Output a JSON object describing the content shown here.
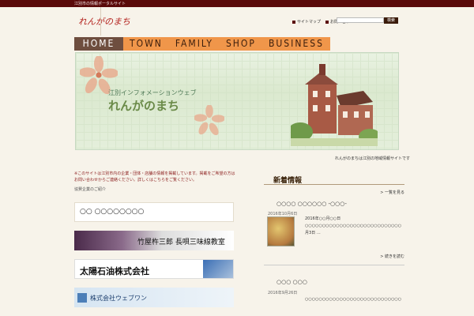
{
  "topbar": {
    "text": "江別市の情報ポータルサイト"
  },
  "header": {
    "logo": "れんがのまち",
    "links": [
      {
        "label": "サイトマップ"
      },
      {
        "label": "お問い合わせ"
      }
    ],
    "search": {
      "placeholder": "",
      "button": "検索"
    }
  },
  "nav": {
    "home": "HOME",
    "items": [
      "TOWN",
      "FAMILY",
      "SHOP",
      "BUSINESS"
    ]
  },
  "banner": {
    "subtitle": "江別インフォメーションウェブ",
    "title": "れんがのまち"
  },
  "below_banner": "れんがのまちは江別の地域情報サイトです",
  "main": {
    "notice": "※このサイトは江別市内の企業・団体・店舗の情報を掲載しています。掲載をご希望の方はお問い合わせからご連絡ください。詳しくはこちらをご覧ください。",
    "small": "協賛企業のご紹介",
    "banners": [
      {
        "title": "○○ ○○○○○○○○",
        "type": "text"
      },
      {
        "title": "竹屋杵三郎 長唄三味線教室",
        "type": "dark"
      },
      {
        "title": "太陽石油株式会社",
        "type": "light"
      },
      {
        "title": "株式会社ウェブワン",
        "type": "blue"
      }
    ]
  },
  "sidebar": {
    "title": "新着情報",
    "more_top": "> 一覧を見る",
    "posts": [
      {
        "title": "○○○○ ○○○○○○ -○○○-",
        "date": "2016年10月6日",
        "text": "2016年○○月○○日○○○○○○○○○○○○○○○○○○○○○○○○○○○○○○○○○○○○○○○○○○○○○○○○○○○○○○○○○○○○○○○○○○○○○○○○○○○○○○○○○○○12月3日 …",
        "more": "> 続きを読む"
      },
      {
        "title": "○○○ ○○○",
        "date": "2016年9月26日",
        "text": "○○○○○○○○○○○○○○○○○○○○○○○○○○○○○○○○○○○○○○○○○○○○○○○○○○○○○○○○○○○○○○"
      }
    ]
  }
}
